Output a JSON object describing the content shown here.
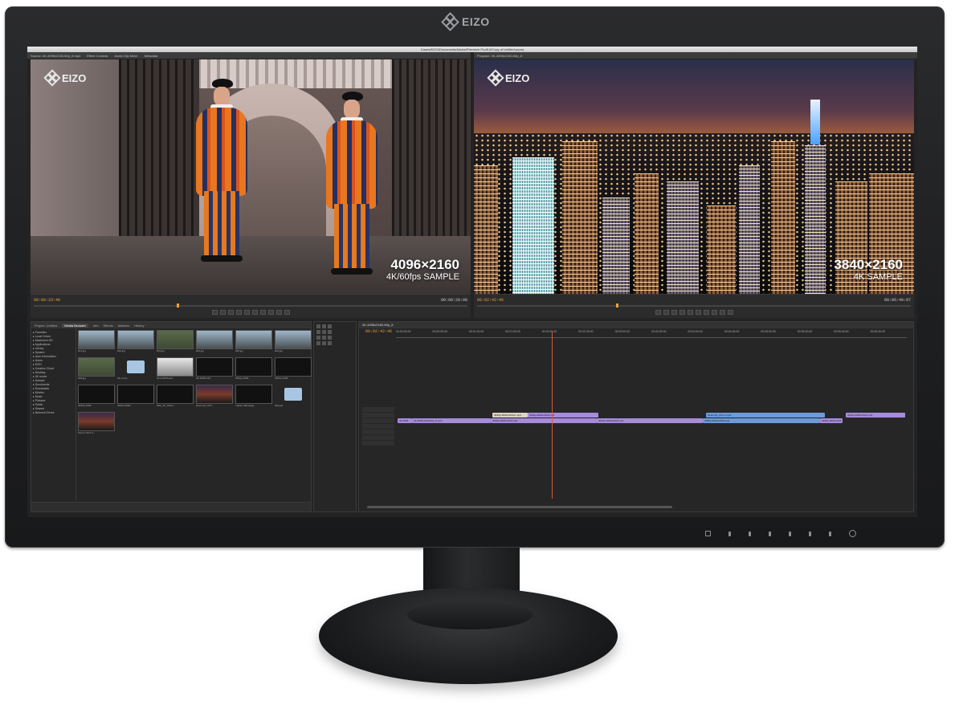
{
  "monitor": {
    "brand": "EIZO"
  },
  "window": {
    "title": "/Users/EIZO/Documents/Adobe/Premiere Pro/8.0/Copy of Untitled.prproj",
    "left_tabs": [
      "Source: 4K-4096x2160-60p_8.mp4",
      "Effect Controls",
      "Audio Clip Mixer",
      "Metadata"
    ],
    "right_tabs": [
      "Program: 4K-4096x2160-60p_8"
    ]
  },
  "source_monitor": {
    "logo": "EIZO",
    "resolution": "4096×2160",
    "caption": "4K/60fps SAMPLE",
    "timecode_current": "00:00:33:48",
    "timecode_end": "00:00:20:00",
    "playhead_fraction": 0.33
  },
  "program_monitor": {
    "logo": "EIZO",
    "resolution": "3840×2160",
    "caption": "4K SAMPLE",
    "timecode_current": "00:02:42:46",
    "timecode_end": "00:06:49:07",
    "playhead_fraction": 0.32
  },
  "transport_icons": [
    "mark-in-icon",
    "mark-out-icon",
    "go-to-in-icon",
    "step-back-icon",
    "play-icon",
    "step-forward-icon",
    "go-to-out-icon",
    "insert-icon",
    "overwrite-icon",
    "export-frame-icon"
  ],
  "project_panel": {
    "tabs": [
      "Project: Untitled",
      "Media Browser",
      "Info",
      "Effects",
      "Markers",
      "History"
    ],
    "active_tab": "Media Browser",
    "tree": [
      "Favorites",
      "Local Drives",
      "Macintosh HD",
      "Applications",
      "Library",
      "System",
      "User Information",
      "Users",
      "EIZO",
      "Creative Cloud",
      "Desktop",
      "4K movie",
      "Sample",
      "Documents",
      "Downloads",
      "Movies",
      "Music",
      "Pictures",
      "Public",
      "Shared",
      "Network Drives"
    ],
    "items": [
      {
        "caption": "001.jpg",
        "style": "sky"
      },
      {
        "caption": "002.jpg",
        "style": "sky"
      },
      {
        "caption": "003.jpg",
        "style": "green"
      },
      {
        "caption": "004.jpg",
        "style": "sky"
      },
      {
        "caption": "005.jpg",
        "style": "sky"
      },
      {
        "caption": "006.jpg",
        "style": "sky"
      },
      {
        "caption": "008.jpg",
        "style": "green"
      },
      {
        "caption": "4K movie",
        "style": "folder"
      },
      {
        "caption": "4K+24FPS+Mi...",
        "style": "snow"
      },
      {
        "caption": "4K-4096x216...",
        "style": "dark"
      },
      {
        "caption": "4K60p-4096...",
        "style": "dark"
      },
      {
        "caption": "4K60p-4096...",
        "style": "dark"
      },
      {
        "caption": "4K60p-4096...",
        "style": "dark"
      },
      {
        "caption": "4K60p-4096...",
        "style": "dark"
      },
      {
        "caption": "60fp_4K_Shoot...",
        "style": "dark"
      },
      {
        "caption": "final-mp4_AVC...",
        "style": "night"
      },
      {
        "caption": "master-4kfootage...",
        "style": "dark"
      },
      {
        "caption": "Sample",
        "style": "folder"
      },
      {
        "caption": "Screen Shot 2...",
        "style": "night"
      }
    ]
  },
  "timeline": {
    "sequence_tab": "4K-4096x2160-60p_8",
    "timecode": "00:02:42:46",
    "ruler_ticks": [
      "00:00:00:00",
      "00:00:30:00",
      "00:01:00:00",
      "00:01:30:00",
      "00:02:00:00",
      "00:02:30:00",
      "00:03:00:00",
      "00:03:30:00",
      "00:04:00:00",
      "00:04:30:00",
      "00:05:00:00",
      "00:05:30:00",
      "00:06:00:00",
      "00:06:30:00"
    ],
    "tracks": [
      "V3",
      "V2",
      "V1",
      "A1",
      "A2",
      "A3",
      "Master"
    ],
    "clips_v2": [
      {
        "label": "4K60p-3840x2160-b.mp4",
        "kind": "w"
      },
      {
        "label": "4K60p-3840x2160.mp4",
        "kind": "v"
      },
      {
        "label": "final-mp4_AVC-1.mp4",
        "kind": "b"
      },
      {
        "label": "4K60p-3840x2160.mp4",
        "kind": "v"
      }
    ],
    "clips_v1": [
      {
        "label": "4K-4096",
        "kind": "v"
      },
      {
        "label": "4K-4096x2160-60p_8.mp4",
        "kind": "v"
      },
      {
        "label": "4K60p-3840x2160.mp4",
        "kind": "v"
      },
      {
        "label": "4K60p-3840x2160.mp4",
        "kind": "v"
      },
      {
        "label": "4K60p-3840x2160.mp4",
        "kind": "b"
      },
      {
        "label": "4K60p-3840x2160",
        "kind": "v"
      }
    ]
  }
}
